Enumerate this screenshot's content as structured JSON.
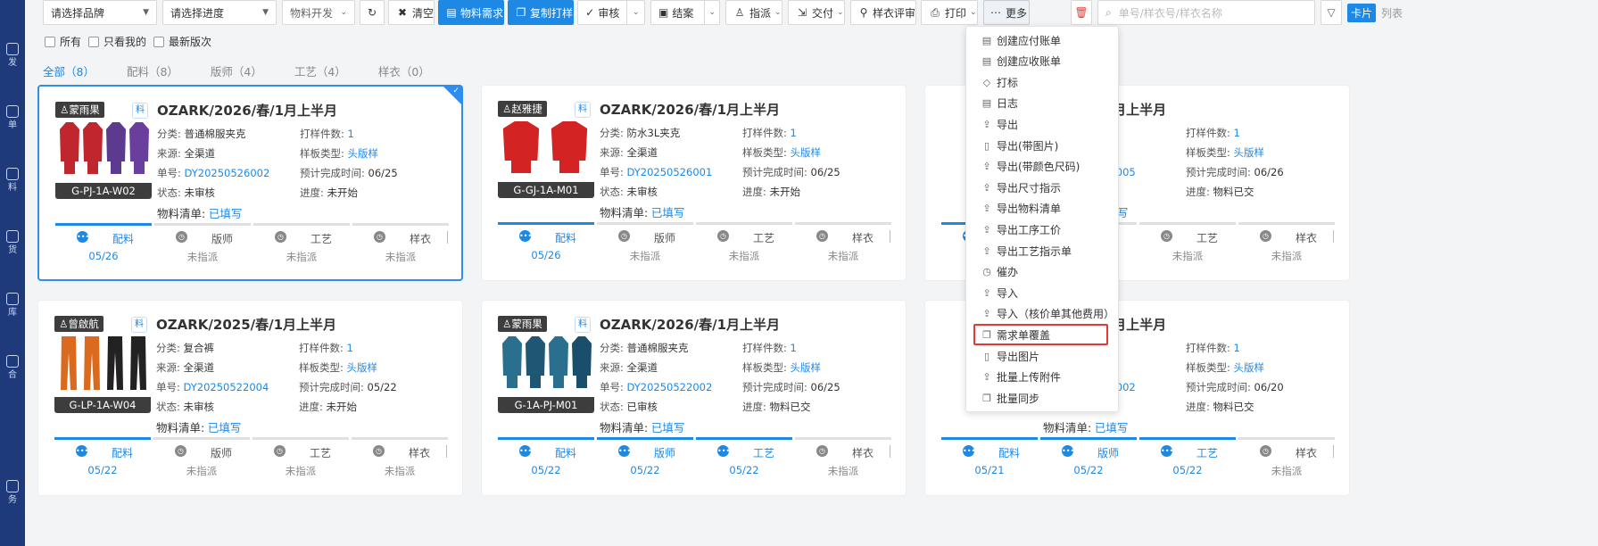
{
  "sidebar": {
    "items": [
      {
        "label": "发",
        "icon": "shirt-icon"
      },
      {
        "label": "单",
        "icon": "doc-icon"
      },
      {
        "label": "料",
        "icon": "material-icon"
      },
      {
        "label": "货",
        "icon": "goods-icon"
      },
      {
        "label": "库",
        "icon": "warehouse-icon"
      },
      {
        "label": "合",
        "icon": "contract-icon"
      },
      {
        "label": "务",
        "icon": "finance-icon"
      }
    ]
  },
  "toolbar": {
    "brand_select": "请选择品牌",
    "progress_select": "请选择进度",
    "dev_select": "物料开发",
    "clear": "清空",
    "material_demand": "物料需求",
    "copy_sample": "复制打样",
    "review": "审核",
    "close_case": "结案",
    "dispatch": "指派",
    "deliver": "交付",
    "sample_review": "样衣评审",
    "print": "打印",
    "more": "更多",
    "search_placeholder": "单号/样衣号/样衣名称",
    "view_card": "卡片",
    "view_list": "列表"
  },
  "filters": {
    "all": "所有",
    "mine": "只看我的",
    "latest": "最新版次"
  },
  "tabs": [
    {
      "label": "全部（8）",
      "active": true
    },
    {
      "label": "配料（8）",
      "active": false
    },
    {
      "label": "版师（4）",
      "active": false
    },
    {
      "label": "工艺（4）",
      "active": false
    },
    {
      "label": "样衣（0）",
      "active": false
    }
  ],
  "labels": {
    "category": "分类:",
    "count": "打样件数:",
    "source": "来源:",
    "pattern_type": "样板类型:",
    "order_no": "单号:",
    "expected_time": "预计完成时间:",
    "status": "状态:",
    "progress": "进度:",
    "bom": "物料清单:",
    "mat_badge": "料",
    "unassigned": "未指派"
  },
  "cards": [
    {
      "owner": "蒙雨果",
      "code": "G-PJ-1A-W02",
      "title": "OZARK/2026/春/1月上半月",
      "category": "普通棉服夹克",
      "count": "1",
      "source": "全渠道",
      "pattern": "头版样",
      "order": "DY20250526002",
      "expected": "06/25",
      "status": "未审核",
      "progress": "未开始",
      "bom": "已填写",
      "steps": [
        {
          "name": "配料",
          "date": "05/26",
          "on": true
        },
        {
          "name": "版师",
          "date": "未指派",
          "on": false
        },
        {
          "name": "工艺",
          "date": "未指派",
          "on": false
        },
        {
          "name": "样衣",
          "date": "未指派",
          "on": false
        }
      ]
    },
    {
      "owner": "赵雅捷",
      "code": "G-GJ-1A-M01",
      "title": "OZARK/2026/春/1月上半月",
      "category": "防水3L夹克",
      "count": "1",
      "source": "全渠道",
      "pattern": "头版样",
      "order": "DY20250526001",
      "expected": "06/25",
      "status": "未审核",
      "progress": "未开始",
      "bom": "已填写",
      "steps": [
        {
          "name": "配料",
          "date": "05/26",
          "on": true
        },
        {
          "name": "版师",
          "date": "未指派",
          "on": false
        },
        {
          "name": "工艺",
          "date": "未指派",
          "on": false
        },
        {
          "name": "样衣",
          "date": "未指派",
          "on": false
        }
      ]
    },
    {
      "owner": "",
      "code": "",
      "title": "2026/春/1月上半月",
      "category": "性长袖T恤",
      "count": "1",
      "source": "",
      "pattern": "头版样",
      "order": "0250522005",
      "expected": "06/26",
      "status": "核",
      "progress": "物料已交",
      "bom": "已填写",
      "steps": [
        {
          "name": "配料",
          "date": "",
          "on": true
        },
        {
          "name": "版师",
          "date": "未指派",
          "on": false
        },
        {
          "name": "工艺",
          "date": "未指派",
          "on": false
        },
        {
          "name": "样衣",
          "date": "未指派",
          "on": false
        }
      ]
    },
    {
      "owner": "曾啟航",
      "code": "G-LP-1A-W04",
      "title": "OZARK/2025/春/1月上半月",
      "category": "复合裤",
      "count": "1",
      "source": "全渠道",
      "pattern": "头版样",
      "order": "DY20250522004",
      "expected": "05/22",
      "status": "未审核",
      "progress": "未开始",
      "bom": "已填写",
      "steps": [
        {
          "name": "配料",
          "date": "05/22",
          "on": true
        },
        {
          "name": "版师",
          "date": "未指派",
          "on": false
        },
        {
          "name": "工艺",
          "date": "未指派",
          "on": false
        },
        {
          "name": "样衣",
          "date": "未指派",
          "on": false
        }
      ]
    },
    {
      "owner": "蒙雨果",
      "code": "G-1A-PJ-M01",
      "title": "OZARK/2026/春/1月上半月",
      "category": "普通棉服夹克",
      "count": "1",
      "source": "全渠道",
      "pattern": "头版样",
      "order": "DY20250522002",
      "expected": "06/25",
      "status": "已审核",
      "progress": "物料已交",
      "bom": "已填写",
      "steps": [
        {
          "name": "配料",
          "date": "05/22",
          "on": true
        },
        {
          "name": "版师",
          "date": "05/22",
          "on": true
        },
        {
          "name": "工艺",
          "date": "05/22",
          "on": true
        },
        {
          "name": "样衣",
          "date": "未指派",
          "on": false
        }
      ]
    },
    {
      "owner": "",
      "code": "",
      "title": "2026/春/1月上半月",
      "category": "裤",
      "count": "1",
      "source": "道",
      "pattern": "头版样",
      "order": "0250521002",
      "expected": "06/20",
      "status": "核",
      "progress": "物料已交",
      "bom": "已填写",
      "steps": [
        {
          "name": "配料",
          "date": "05/21",
          "on": true
        },
        {
          "name": "版师",
          "date": "05/22",
          "on": true
        },
        {
          "name": "工艺",
          "date": "05/22",
          "on": true
        },
        {
          "name": "样衣",
          "date": "未指派",
          "on": false
        }
      ]
    }
  ],
  "more_menu": [
    {
      "label": "创建应付账单",
      "icon": "bill-icon"
    },
    {
      "label": "创建应收账单",
      "icon": "bill-icon"
    },
    {
      "label": "打标",
      "icon": "tag-icon"
    },
    {
      "label": "日志",
      "icon": "log-icon"
    },
    {
      "label": "导出",
      "icon": "export-icon"
    },
    {
      "label": "导出(带图片)",
      "icon": "file-icon"
    },
    {
      "label": "导出(带颜色尺码)",
      "icon": "export-icon"
    },
    {
      "label": "导出尺寸指示",
      "icon": "export-icon"
    },
    {
      "label": "导出物料清单",
      "icon": "export-icon"
    },
    {
      "label": "导出工序工价",
      "icon": "export-icon"
    },
    {
      "label": "导出工艺指示单",
      "icon": "export-icon"
    },
    {
      "label": "催办",
      "icon": "clock-icon"
    },
    {
      "label": "导入",
      "icon": "import-icon"
    },
    {
      "label": "导入（核价单其他费用）",
      "icon": "import-icon"
    },
    {
      "label": "需求单覆盖",
      "icon": "copy-icon"
    },
    {
      "label": "导出图片",
      "icon": "file-icon"
    },
    {
      "label": "批量上传附件",
      "icon": "upload-icon"
    },
    {
      "label": "批量同步",
      "icon": "copy-icon"
    }
  ],
  "colors": {
    "primary": "#1e88e5",
    "highlight": "#e53935",
    "sidebar": "#1f3a7a"
  }
}
